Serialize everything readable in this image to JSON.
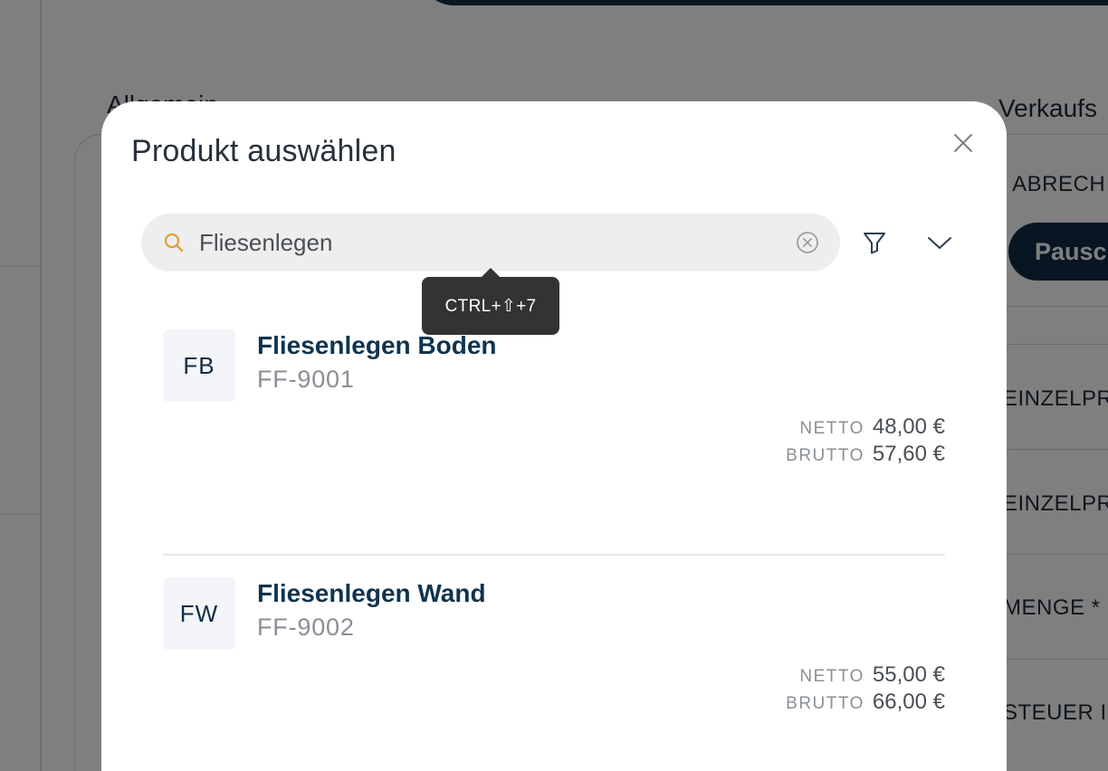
{
  "background": {
    "left_title": "Allgemein",
    "right_title": "Verkaufs",
    "labels": [
      "ABRECH",
      "EINZELPRE",
      "EINZELPRE",
      "MENGE *",
      "STEUER IN"
    ],
    "required_mark": "*",
    "pill": "Pausc"
  },
  "modal": {
    "title": "Produkt auswählen",
    "close_icon": "close-icon"
  },
  "search": {
    "value": "Fliesenlegen",
    "icon": "search-icon",
    "clear_icon": "clear-circle-icon",
    "filter_icon": "filter-icon",
    "expand_icon": "chevron-down-icon",
    "accent_color": "#e0a030"
  },
  "tooltip": {
    "shortcut": "CTRL+⇧+7"
  },
  "products": [
    {
      "initials": "FB",
      "name": "Fliesenlegen Boden",
      "sku": "FF-9001",
      "netto_label": "NETTO",
      "netto": "48,00 €",
      "brutto_label": "BRUTTO",
      "brutto": "57,60 €"
    },
    {
      "initials": "FW",
      "name": "Fliesenlegen Wand",
      "sku": "FF-9002",
      "netto_label": "NETTO",
      "netto": "55,00 €",
      "brutto_label": "BRUTTO",
      "brutto": "66,00 €"
    }
  ],
  "colors": {
    "brand_dark": "#0f2d44",
    "overlay": "rgba(0,0,0,0.5)"
  }
}
